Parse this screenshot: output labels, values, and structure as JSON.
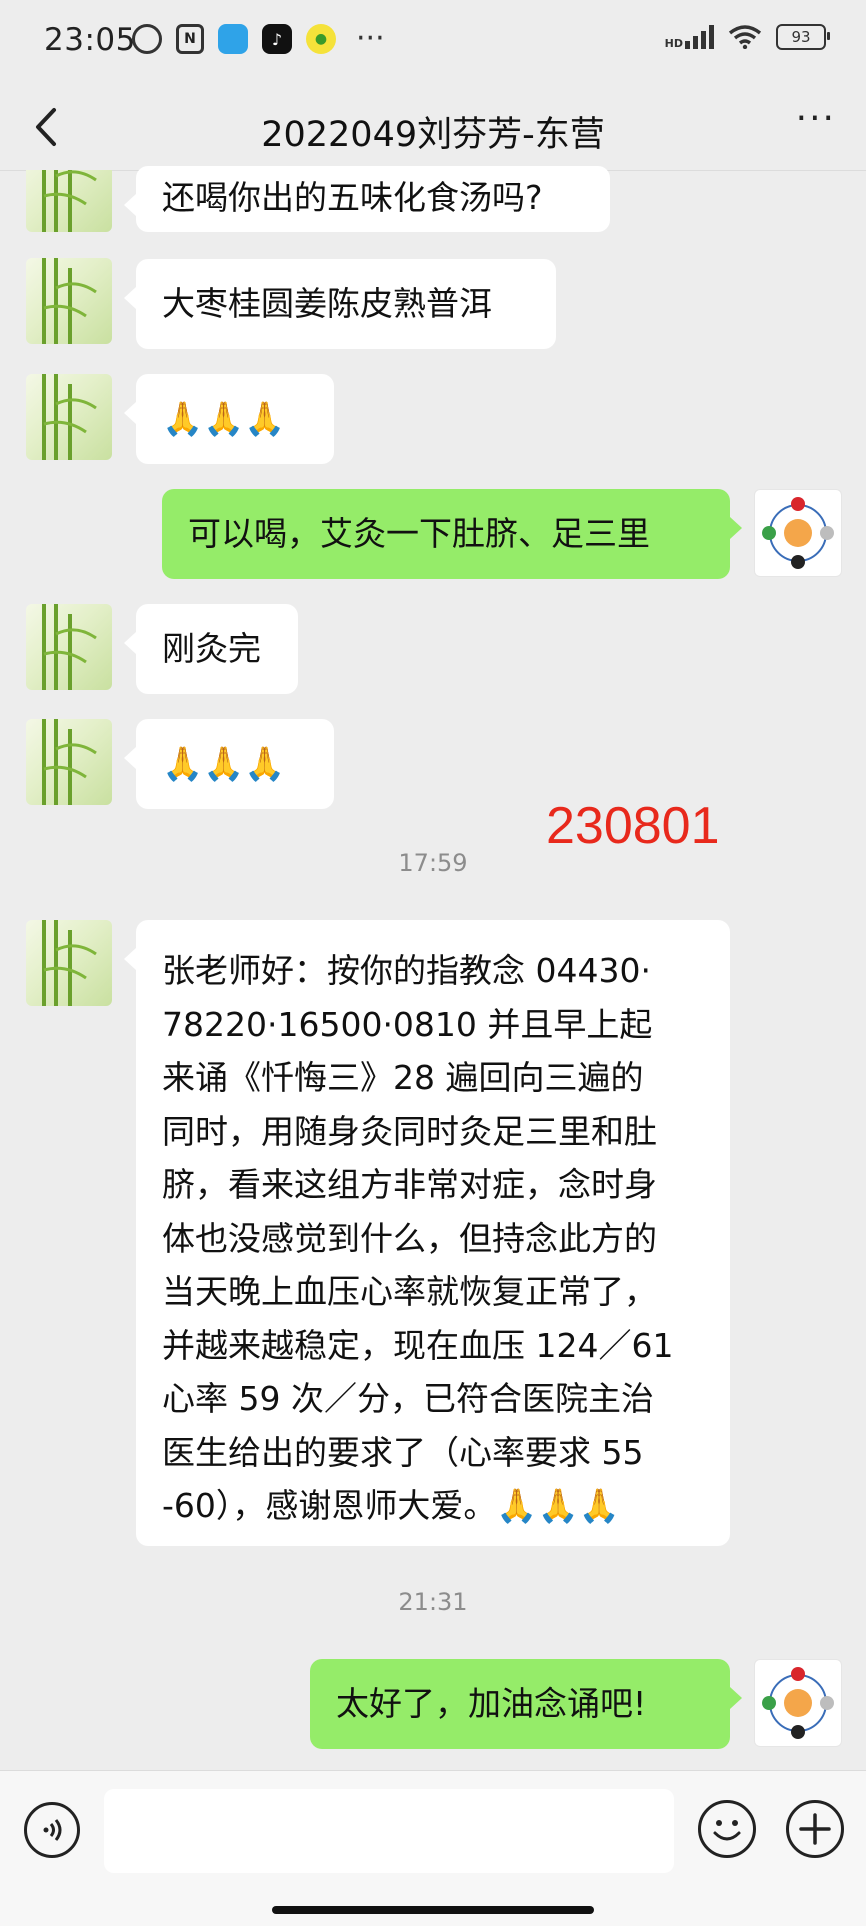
{
  "status_bar": {
    "time": "23:05",
    "network_label": "HD",
    "battery": "93",
    "more": "···",
    "icons": [
      "alarm-icon",
      "nfc-icon",
      "app-blue-icon",
      "tiktok-icon",
      "coin-icon",
      "signal-icon",
      "wifi-icon",
      "battery-icon"
    ]
  },
  "nav": {
    "title": "2022049刘芬芳-东营",
    "back_icon": "chevron-left-icon",
    "more": "···"
  },
  "messages": [
    {
      "side": "in",
      "text": "还喝你出的五味化食汤吗?"
    },
    {
      "side": "in",
      "text": "大枣桂圆姜陈皮熟普洱"
    },
    {
      "side": "in",
      "text": "🙏🙏🙏"
    },
    {
      "side": "out",
      "text": "可以喝，艾灸一下肚脐、足三里"
    },
    {
      "side": "in",
      "text": "刚灸完"
    },
    {
      "side": "in",
      "text": "🙏🙏🙏"
    },
    {
      "side": "in",
      "lines": [
        "张老师好：按你的指教念 04430·",
        "78220·16500·0810 并且早上起",
        "来诵《忏悔三》28 遍回向三遍的",
        "同时，用随身灸同时灸足三里和肚",
        "脐，看来这组方非常对症，念时身",
        "体也没感觉到什么，但持念此方的",
        "当天晚上血压心率就恢复正常了，",
        "并越来越稳定，现在血压 124／61",
        "心率 59 次／分，已符合医院主治",
        "医生给出的要求了（心率要求 55",
        "-60），感谢恩师大爱。🙏🙏🙏"
      ]
    },
    {
      "side": "out",
      "text": "太好了，加油念诵吧!"
    }
  ],
  "timestamps": [
    "17:59",
    "21:31"
  ],
  "stamp": "230801",
  "input_bar": {
    "voice_icon": "voice-icon",
    "emoji_icon": "emoji-icon",
    "plus_icon": "plus-icon"
  },
  "colors": {
    "background": "#ededed",
    "bubble_out": "#95ec69",
    "bubble_in": "#ffffff",
    "stamp": "#e8291c"
  }
}
